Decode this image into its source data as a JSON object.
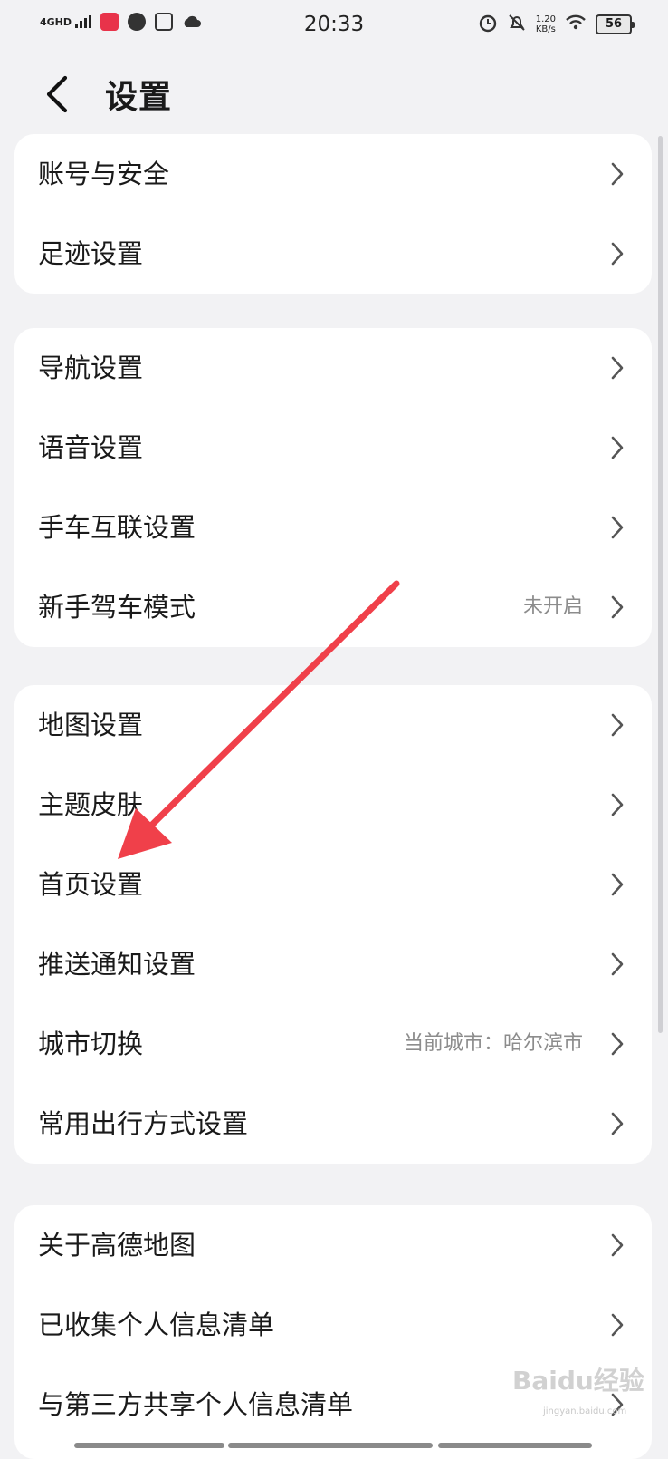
{
  "status_bar": {
    "network": "4GHD",
    "time": "20:33",
    "speed_value": "1.20",
    "speed_unit": "KB/s",
    "battery": "56"
  },
  "header": {
    "title": "设置"
  },
  "groups": [
    {
      "items": [
        {
          "label": "账号与安全"
        },
        {
          "label": "足迹设置"
        }
      ]
    },
    {
      "items": [
        {
          "label": "导航设置"
        },
        {
          "label": "语音设置"
        },
        {
          "label": "手车互联设置"
        },
        {
          "label": "新手驾车模式",
          "value": "未开启"
        }
      ]
    },
    {
      "items": [
        {
          "label": "地图设置"
        },
        {
          "label": "主题皮肤"
        },
        {
          "label": "首页设置"
        },
        {
          "label": "推送通知设置"
        },
        {
          "label": "城市切换",
          "value": "当前城市：哈尔滨市"
        },
        {
          "label": "常用出行方式设置"
        }
      ]
    },
    {
      "items": [
        {
          "label": "关于高德地图"
        },
        {
          "label": "已收集个人信息清单"
        },
        {
          "label": "与第三方共享个人信息清单"
        }
      ]
    }
  ],
  "watermark": {
    "brand": "Baidu经验",
    "url": "jingyan.baidu.com"
  },
  "colors": {
    "background": "#f2f2f4",
    "card": "#ffffff",
    "annotation_arrow": "#f0404a"
  }
}
